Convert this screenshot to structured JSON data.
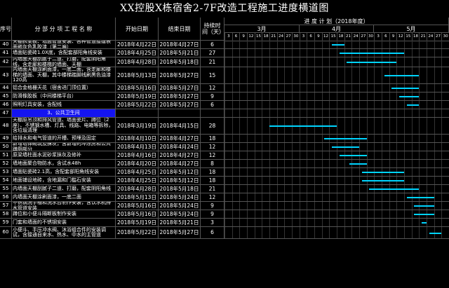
{
  "title": "XX控股X栋宿舍2-7F改造工程施工进度横道图",
  "headers": {
    "no": "序号",
    "name": "分 部 分 项 工 程 名 称",
    "start": "开始日期",
    "end": "结束日期",
    "duration": "持续时间（天）",
    "schedule": "进 度 计 划（2018年度）",
    "months": [
      "3月",
      "4月",
      "5月"
    ]
  },
  "days": [
    "3",
    "6",
    "9",
    "12",
    "15",
    "18",
    "21",
    "24",
    "27",
    "30",
    "3",
    "6",
    "9",
    "12",
    "15",
    "18",
    "21",
    "24",
    "27",
    "30",
    "3",
    "6",
    "9",
    "12",
    "15",
    "18",
    "21",
    "24",
    "27",
    "30"
  ],
  "colors": {
    "bar": "#00d4ff",
    "section_fill": "#1414f0"
  },
  "rows": [
    {
      "no": "40",
      "name": "天棚拆梁板、墙面管道安装、各种管道接缝表面嵌灰色乳胶漆（第二遍）",
      "start": "2018年4月22日",
      "end": "2018年4月27日",
      "dur": "6",
      "bar": [
        43,
        48
      ]
    },
    {
      "no": "41",
      "name": "墙面贴瓷砖1.0X底，含配套部阳角线安装",
      "start": "2018年4月25日",
      "end": "2018年5月21日",
      "dur": "27",
      "bar": [
        46,
        72
      ]
    },
    {
      "no": "42",
      "name": "内墙面天棚刮腻子二道、打磨，配套阴阳角线，含走廊和楼梯的墙面、天棚",
      "start": "2018年4月28日",
      "end": "2018年5月18日",
      "dur": "21",
      "bar": [
        49,
        69
      ]
    },
    {
      "no": "43",
      "name": "内墙面天棚涂刷面漆，一底二面，含走廊和楼梯的墙面、天棚，其中楼梯踏脚线刷黑色油漆120高",
      "start": "2018年5月13日",
      "end": "2018年5月27日",
      "dur": "15",
      "bar": [
        64,
        78
      ]
    },
    {
      "no": "44",
      "name": "铝合金格栅天花（宿舍进门顶位置）",
      "start": "2018年5月16日",
      "end": "2018年5月27日",
      "dur": "12",
      "bar": [
        67,
        78
      ]
    },
    {
      "no": "45",
      "name": "防滑橡胶板（中间楼梯平台）",
      "start": "2018年5月19日",
      "end": "2018年5月27日",
      "dur": "9",
      "bar": [
        70,
        78
      ]
    },
    {
      "no": "46",
      "name": "照明灯具安装，含配线",
      "start": "2018年5月22日",
      "end": "2018年5月27日",
      "dur": "6",
      "bar": [
        73,
        78
      ]
    },
    {
      "no": "47",
      "section": true,
      "name": "3、公共卫生间",
      "start": "",
      "end": "",
      "dur": "",
      "bar": null
    },
    {
      "no": "48",
      "name": "天棚原吊顶和排风管道、墙面瓷片、蹲位（2座）、不锈钢水槽、灯具、线路、电箱等拆除，含垃圾清理",
      "start": "2018年3月19日",
      "end": "2018年4月15日",
      "dur": "28",
      "bar": [
        18,
        45
      ]
    },
    {
      "no": "49",
      "name": "给排水和电气管道的开槽、预埋及固定",
      "start": "2018年4月10日",
      "end": "2018年4月27日",
      "dur": "18",
      "bar": [
        40,
        57
      ]
    },
    {
      "no": "50",
      "name": "新增墙体砌筑及抹灰，含新增的冲凉房和公共蹲厕部分",
      "start": "2018年4月13日",
      "end": "2018年4月24日",
      "dur": "12",
      "bar": [
        43,
        54
      ]
    },
    {
      "no": "51",
      "name": "原梁墙柱面水泥砂浆抹灰及修补",
      "start": "2018年4月16日",
      "end": "2018年4月27日",
      "dur": "12",
      "bar": [
        46,
        57
      ]
    },
    {
      "no": "52",
      "name": "墙地面聚合物防水，含试水48h",
      "start": "2018年4月20日",
      "end": "2018年4月27日",
      "dur": "8",
      "bar": [
        50,
        57
      ]
    },
    {
      "no": "53",
      "name": "墙面贴瓷砖2.1高，含配套部阳角线安装",
      "start": "2018年4月25日",
      "end": "2018年5月12日",
      "dur": "18",
      "bar": [
        55,
        72
      ]
    },
    {
      "no": "54",
      "name": "地面铺设地砖，含地漏和门槛石安装",
      "start": "2018年4月25日",
      "end": "2018年5月12日",
      "dur": "18",
      "bar": [
        55,
        72
      ]
    },
    {
      "no": "55",
      "name": "内墙面天棚刮腻子二道、打磨，配套阴阳角线",
      "start": "2018年4月28日",
      "end": "2018年5月18日",
      "dur": "21",
      "bar": [
        58,
        78
      ]
    },
    {
      "no": "56",
      "name": "内墙面天棚涂刷面漆，一底二面",
      "start": "2018年5月13日",
      "end": "2018年5月24日",
      "dur": "12",
      "bar": [
        73,
        84
      ]
    },
    {
      "no": "57",
      "name": "不锈钢洗手槽和洗水台制作安装，含饮水机排水管道安装",
      "start": "2018年5月16日",
      "end": "2018年5月24日",
      "dur": "9",
      "bar": [
        76,
        84
      ]
    },
    {
      "no": "58",
      "name": "蹲位和小便斗隔断板制作安装",
      "start": "2018年5月16日",
      "end": "2018年5月24日",
      "dur": "9",
      "bar": [
        76,
        84
      ]
    },
    {
      "no": "59",
      "name": "门套和墙面的不锈钢安装",
      "start": "2018年5月19日",
      "end": "2018年5月21日",
      "dur": "3",
      "bar": [
        79,
        81
      ]
    },
    {
      "no": "60",
      "name": "小便斗、手压冲水阀、沐浴组合件的安装调试，含接通自来水、热水、中水的主管道",
      "start": "2018年5月22日",
      "end": "2018年5月27日",
      "dur": "6",
      "bar": [
        82,
        87
      ]
    }
  ]
}
